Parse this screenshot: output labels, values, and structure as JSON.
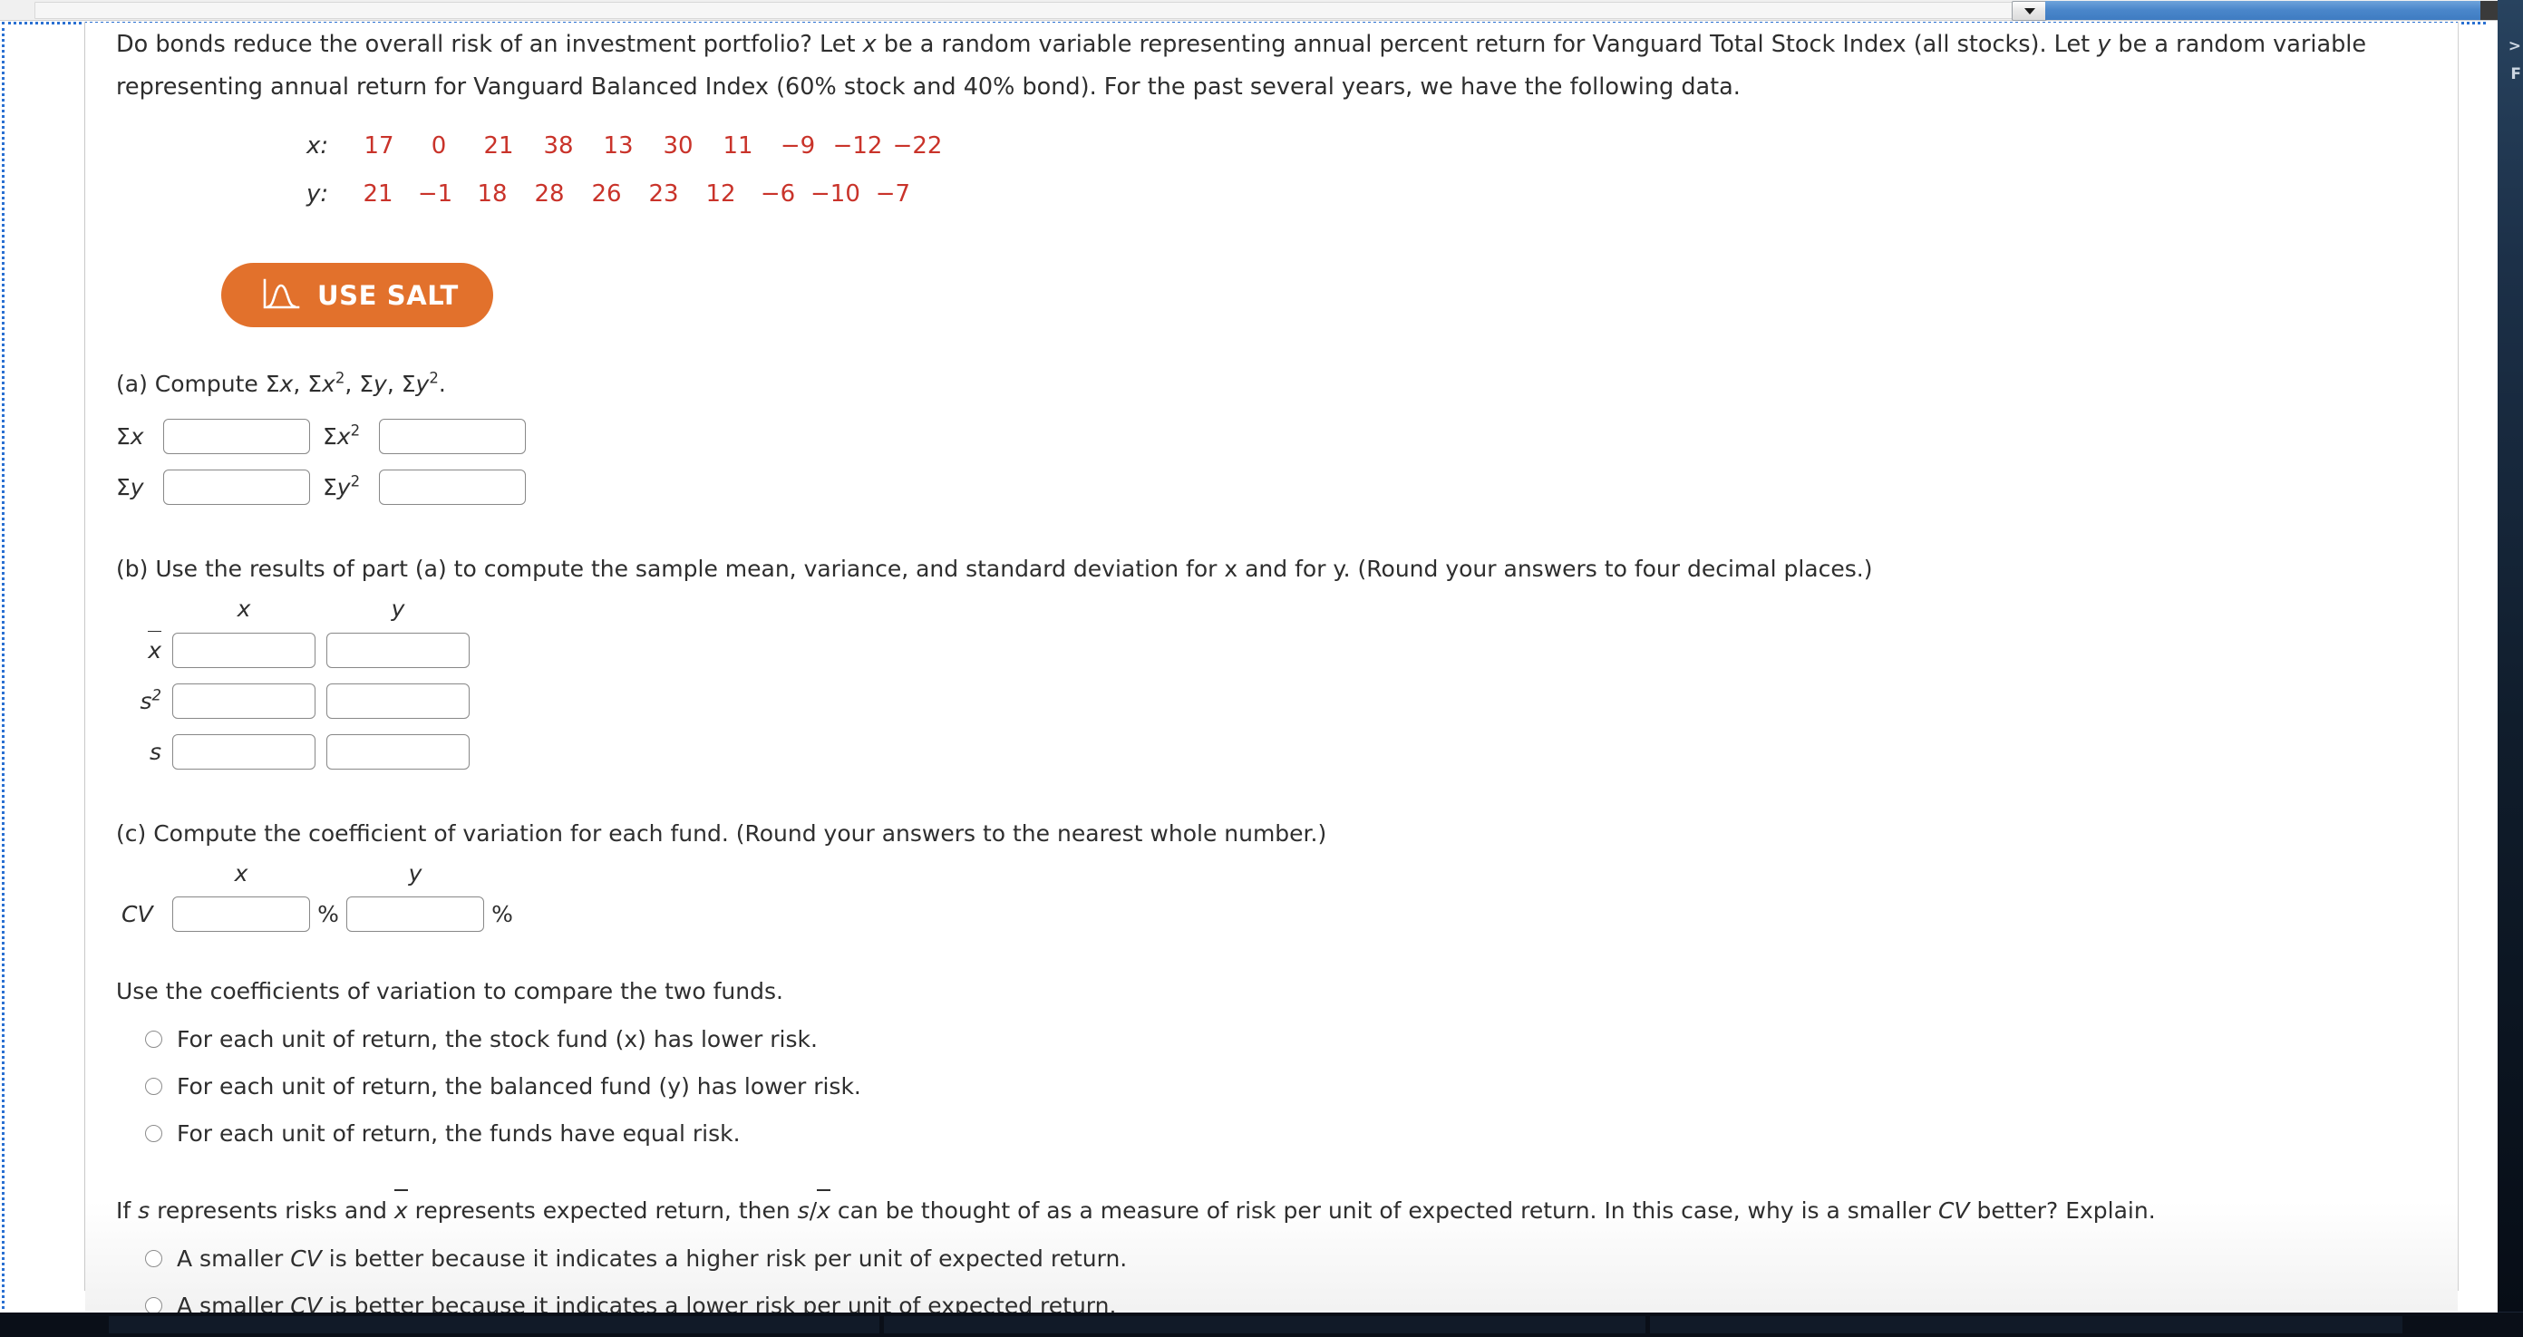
{
  "window": {
    "dropdown_caret": "caret-down",
    "scrollbar": "horizontal-scrollbar"
  },
  "question": {
    "intro_1": "Do bonds reduce the overall risk of an investment portfolio? Let ",
    "var_x": "x",
    "intro_2": " be a random variable representing annual percent return for Vanguard Total Stock Index (all stocks). Let ",
    "var_y": "y",
    "intro_3": " be a random variable representing annual return for Vanguard Balanced Index (60% stock and 40% bond). For the past several years, we have the following data."
  },
  "data_table": {
    "x_label": "x:",
    "y_label": "y:",
    "x_values": [
      "17",
      "0",
      "21",
      "38",
      "13",
      "30",
      "11",
      "−9",
      "−12",
      "−22"
    ],
    "y_values": [
      "21",
      "−1",
      "18",
      "28",
      "26",
      "23",
      "12",
      "−6",
      "−10",
      "−7"
    ]
  },
  "salt": {
    "label": "USE SALT",
    "icon": "normal-distribution-curve-icon",
    "color": "#e2712c"
  },
  "part_a": {
    "prompt_pre": "(a) Compute Σ",
    "prompt_full": "(a) Compute Σx, Σx2, Σy, Σy2.",
    "labels": {
      "sum_x": "Σx",
      "sum_x2_base": "Σx",
      "sum_x2_exp": "2",
      "sum_y": "Σy",
      "sum_y2_base": "Σy",
      "sum_y2_exp": "2"
    },
    "values": {
      "sum_x": "",
      "sum_x2": "",
      "sum_y": "",
      "sum_y2": ""
    }
  },
  "part_b": {
    "prompt": "(b) Use the results of part (a) to compute the sample mean, variance, and standard deviation for x and for y. (Round your answers to four decimal places.)",
    "headers": {
      "x": "x",
      "y": "y"
    },
    "rows": [
      {
        "label": "x",
        "label_kind": "x-bar",
        "value_x": "",
        "value_y": ""
      },
      {
        "label": "s",
        "label_kind": "s-squared",
        "exp": "2",
        "value_x": "",
        "value_y": ""
      },
      {
        "label": "s",
        "label_kind": "s",
        "value_x": "",
        "value_y": ""
      }
    ]
  },
  "part_c": {
    "prompt": "(c) Compute the coefficient of variation for each fund. (Round your answers to the nearest whole number.)",
    "headers": {
      "x": "x",
      "y": "y"
    },
    "row_label": "CV",
    "value_x": "",
    "value_y": "",
    "percent_x": "%",
    "percent_y": "%",
    "compare_prompt": "Use the coefficients of variation to compare the two funds.",
    "options": [
      "For each unit of return, the stock fund (x) has lower risk.",
      "For each unit of return, the balanced fund (y) has lower risk.",
      "For each unit of return, the funds have equal risk."
    ],
    "selected_option": null
  },
  "final": {
    "prompt_a": "If ",
    "prompt_s": "s",
    "prompt_b": " represents risks and ",
    "prompt_xbar": "x",
    "prompt_c": " represents expected return, then ",
    "prompt_ratio_s": "s",
    "prompt_ratio_slash": "/",
    "prompt_ratio_x": "x",
    "prompt_d": " can be thought of as a measure of risk per unit of expected return. In this case, why is a smaller ",
    "prompt_cv": "CV",
    "prompt_e": " better? Explain.",
    "options": [
      {
        "pre": "A smaller ",
        "cv": "CV",
        "post": " is better because it indicates a higher risk per unit of expected return."
      },
      {
        "pre": "A smaller ",
        "cv": "CV",
        "post": " is better because it indicates a lower risk per unit of expected return."
      }
    ],
    "selected_option": null
  }
}
